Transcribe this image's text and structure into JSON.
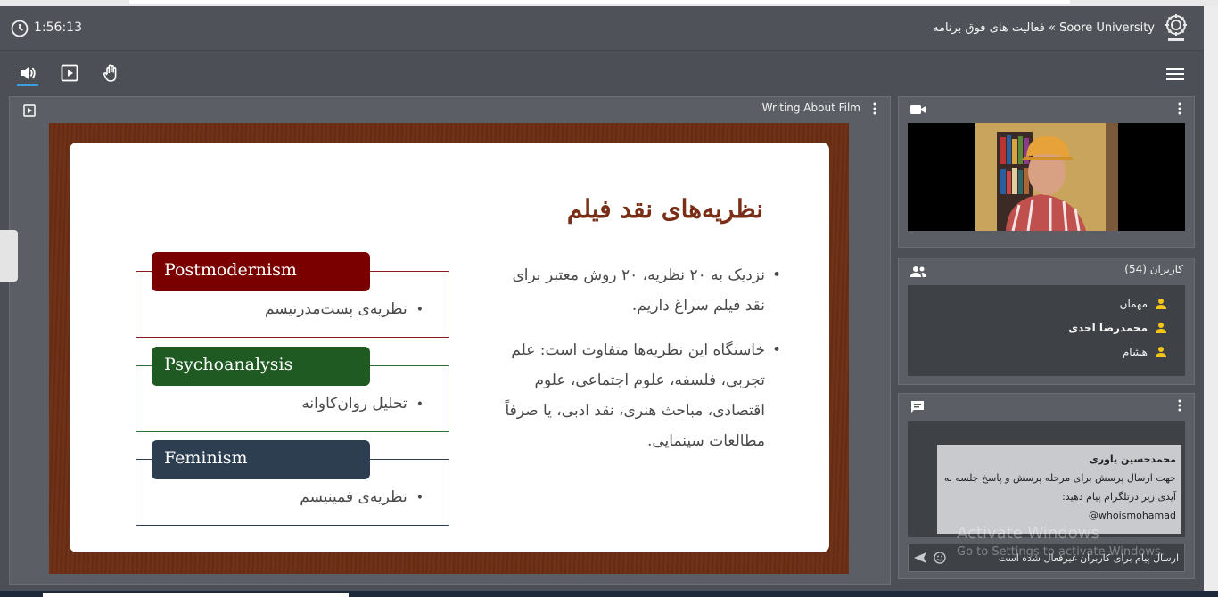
{
  "header": {
    "timer": "1:56:13",
    "breadcrumb": "Soore University » فعالیت های فوق برنامه"
  },
  "presentation": {
    "title": "Writing About Film",
    "slide": {
      "title": "نظریه‌های نقد فیلم",
      "bullets": [
        "نزدیک به ۲۰ نظریه، ۲۰ روش معتبر برای نقد فیلم سراغ داریم.",
        "خاستگاه این نظریه‌ها متفاوت است: علم تجربی، فلسفه، علوم اجتماعی، علوم اقتصادی، مباحث هنری، نقد ادبی، یا صرفاً مطالعات سینمایی."
      ],
      "bullet_glyph": "•",
      "theories": [
        {
          "label": "Postmodernism",
          "desc": "نظریه‌ی پست‌مدرنیسم",
          "color": "#7a0000"
        },
        {
          "label": "Psychoanalysis",
          "desc": "تحلیل روان‌کاوانه",
          "color": "#1e5a22"
        },
        {
          "label": "Feminism",
          "desc": "نظریه‌ی فمینیسم",
          "color": "#2c3e50"
        }
      ]
    }
  },
  "users": {
    "title": "کاربران (54)",
    "items": [
      {
        "name": "مهمان"
      },
      {
        "name": "محمدرضا احدی"
      },
      {
        "name": "هشام"
      }
    ]
  },
  "chat": {
    "author": "محمدحسین یاوری",
    "message": "جهت ارسال پرسش برای مرحله پرسش و پاسخ جلسه به آیدی زیر درتلگرام پیام دهید:",
    "handle": "whoismohamad@",
    "input_placeholder": "ارسال پیام برای کاربران غیرفعال شده است"
  },
  "watermark": {
    "line1": "Activate Windows",
    "line2": "Go to Settings to activate Windows."
  },
  "icons": {
    "clock": "clock-icon",
    "speaker": "speaker-icon",
    "play": "play-icon",
    "hand": "raise-hand-icon",
    "menu": "hamburger-menu-icon",
    "camera": "camera-icon",
    "users": "users-icon",
    "chat": "chat-icon",
    "send": "send-icon",
    "emoji": "emoji-icon"
  },
  "colors": {
    "accent": "#3aa0e0",
    "user_icon": "#f5c518",
    "slide_title": "#7a2e17",
    "slide_frame": "#6b2e14"
  }
}
